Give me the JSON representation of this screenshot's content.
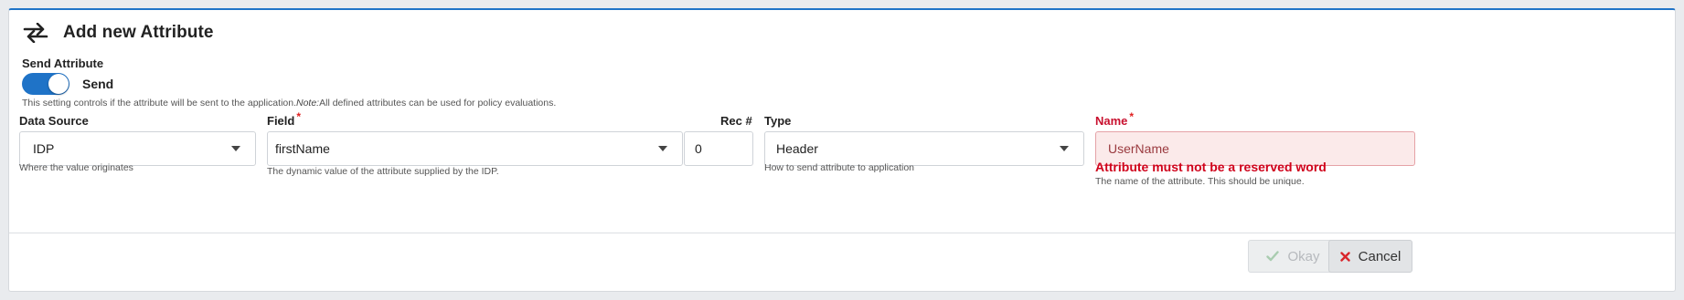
{
  "dialog": {
    "title": "Add new Attribute"
  },
  "send_attribute": {
    "label": "Send Attribute",
    "toggle_state": "on",
    "toggle_text": "Send",
    "help_prefix": "This setting controls if the attribute will be sent to the application.",
    "help_note": "Note:",
    "help_suffix": "All defined attributes can be used for policy evaluations."
  },
  "data_source": {
    "label": "Data Source",
    "value": "IDP",
    "help": "Where the value originates"
  },
  "field": {
    "label": "Field",
    "required_mark": "*",
    "value": "firstName",
    "help": "The dynamic value of the attribute supplied by the IDP."
  },
  "rec": {
    "label": "Rec #",
    "value": "0"
  },
  "type": {
    "label": "Type",
    "value": "Header",
    "help": "How to send attribute to application"
  },
  "name": {
    "label": "Name",
    "required_mark": "*",
    "value": "UserName",
    "error": "Attribute must not be a reserved word",
    "help": "The name of the attribute. This should be unique."
  },
  "buttons": {
    "okay": "Okay",
    "cancel": "Cancel"
  },
  "colors": {
    "accent": "#1f73c7",
    "error": "#d0021b",
    "required": "#e02020",
    "cancel_icon": "#d9262b",
    "okay_icon": "#a9ccb0"
  },
  "icons": {
    "header": "swap-arrows-icon",
    "okay": "checkmark-icon",
    "cancel": "close-x-icon",
    "dropdown": "caret-down-icon"
  }
}
